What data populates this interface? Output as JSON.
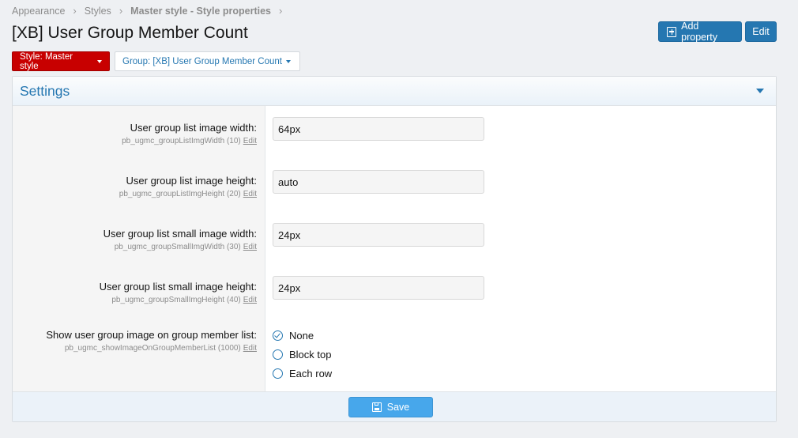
{
  "breadcrumb": [
    {
      "label": "Appearance"
    },
    {
      "label": "Styles"
    },
    {
      "label": "Master style - Style properties"
    }
  ],
  "page": {
    "title": "[XB] User Group Member Count"
  },
  "actions": {
    "add_property": "Add property",
    "edit": "Edit"
  },
  "menus": {
    "style": "Style: Master style",
    "group": "Group: [XB] User Group Member Count"
  },
  "panel": {
    "title": "Settings"
  },
  "properties": [
    {
      "label": "User group list image width:",
      "hint": "pb_ugmc_groupListImgWidth (10)",
      "edit": "Edit",
      "value": "64px"
    },
    {
      "label": "User group list image height:",
      "hint": "pb_ugmc_groupListImgHeight (20)",
      "edit": "Edit",
      "value": "auto"
    },
    {
      "label": "User group list small image width:",
      "hint": "pb_ugmc_groupSmallImgWidth (30)",
      "edit": "Edit",
      "value": "24px"
    },
    {
      "label": "User group list small image height:",
      "hint": "pb_ugmc_groupSmallImgHeight (40)",
      "edit": "Edit",
      "value": "24px"
    }
  ],
  "radio_property": {
    "label": "Show user group image on group member list:",
    "hint": "pb_ugmc_showImageOnGroupMemberList (1000)",
    "edit": "Edit",
    "options": [
      "None",
      "Block top",
      "Each row"
    ],
    "selected": "None"
  },
  "footer": {
    "save": "Save"
  },
  "colors": {
    "accent": "#2577b1",
    "style_menu": "#c80000",
    "save_button": "#47a7eb"
  }
}
